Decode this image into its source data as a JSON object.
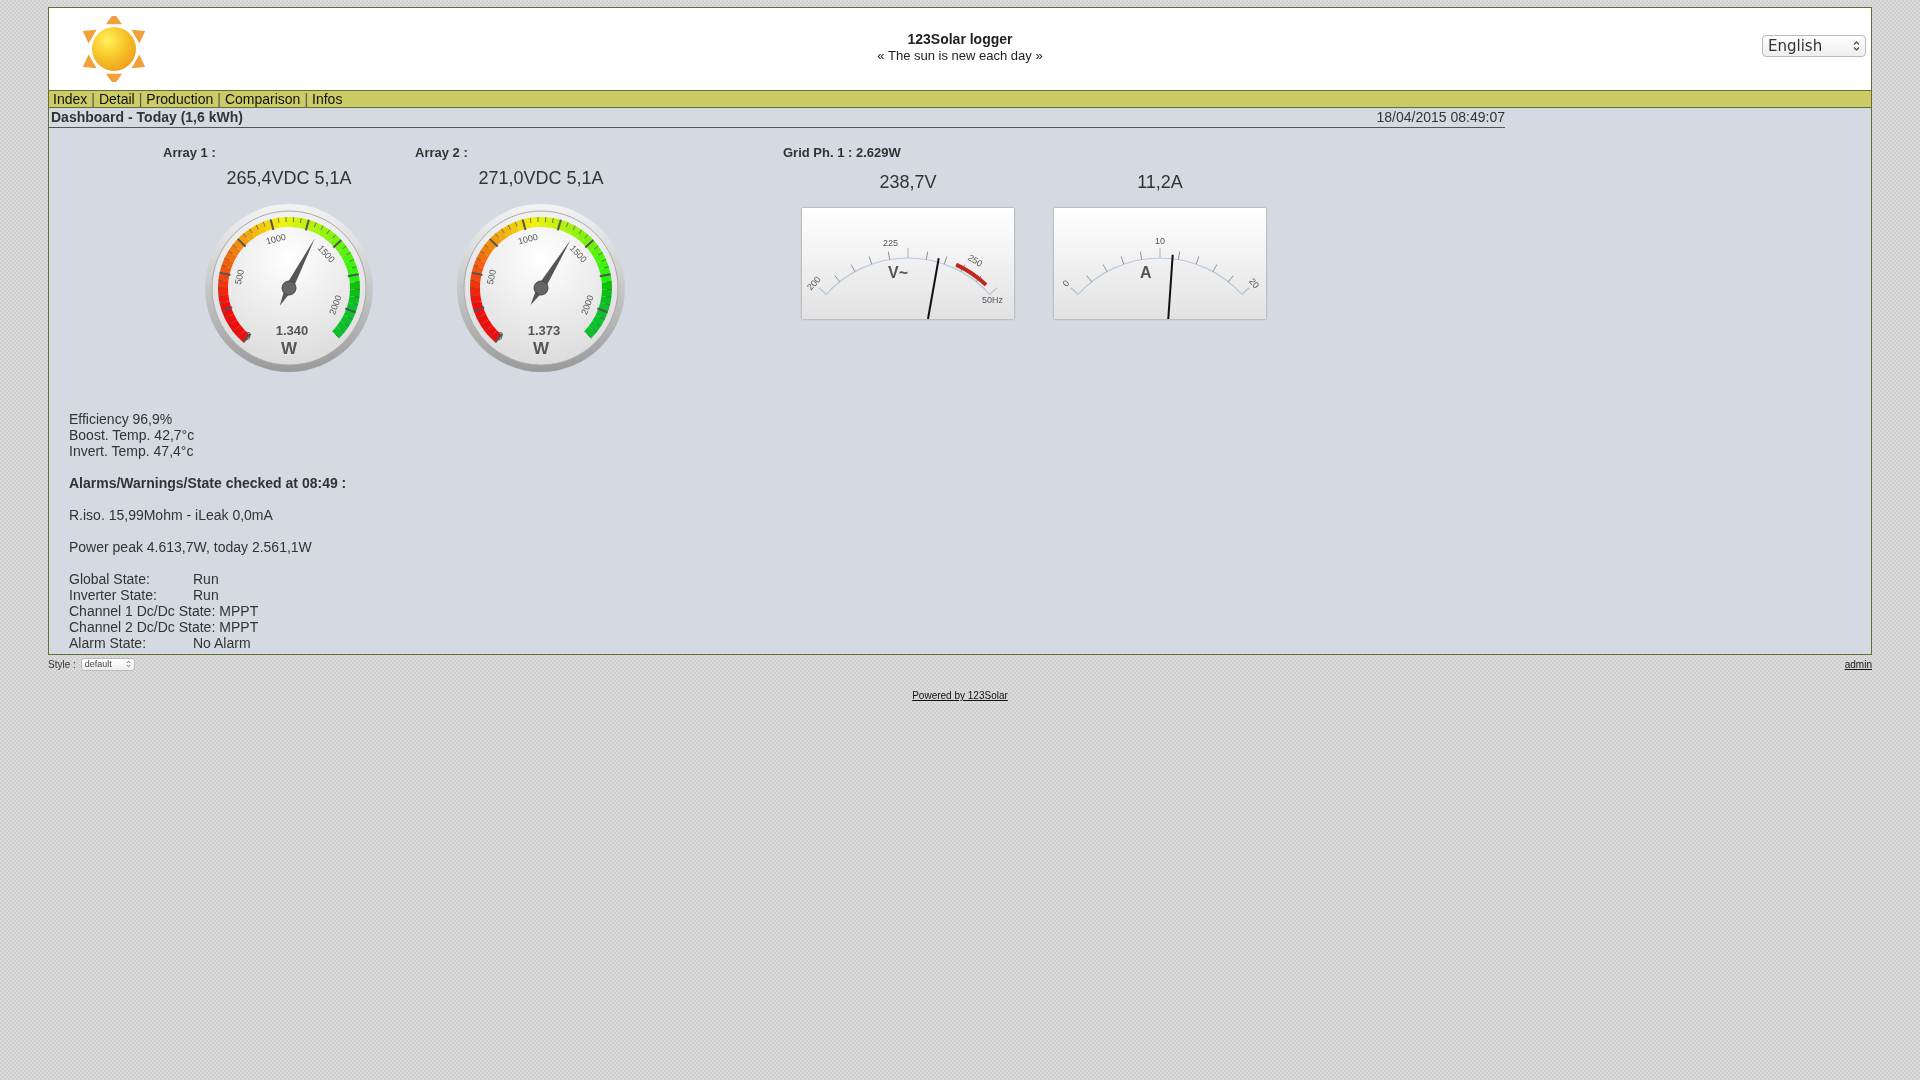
{
  "header": {
    "title": "123Solar logger",
    "subtitle": "« The sun is new each day »",
    "language": "English"
  },
  "nav": [
    {
      "kind": "link",
      "label": "Index"
    },
    {
      "kind": "separator",
      "label": "|"
    },
    {
      "kind": "link",
      "label": "Detail"
    },
    {
      "kind": "separator",
      "label": "|"
    },
    {
      "kind": "link",
      "label": "Production"
    },
    {
      "kind": "separator",
      "label": "|"
    },
    {
      "kind": "link",
      "label": "Comparison"
    },
    {
      "kind": "separator",
      "label": "|"
    },
    {
      "kind": "link",
      "label": "Infos"
    }
  ],
  "dashboard": {
    "title": "Dashboard - Today (1,6 kWh)",
    "datetime": "18/04/2015 08:49:07"
  },
  "arrays": [
    {
      "label": "Array 1 :",
      "reading": "265,4VDC 5,1A",
      "gauge": {
        "scale": [
          "0",
          "500",
          "1000",
          "1500",
          "2000"
        ],
        "value": "1.340",
        "unit": "W",
        "level": 0.609
      }
    },
    {
      "label": "Array 2 :",
      "reading": "271,0VDC 5,1A",
      "gauge": {
        "scale": [
          "0",
          "500",
          "1000",
          "1500",
          "2000"
        ],
        "value": "1.373",
        "unit": "W",
        "level": 0.624
      }
    }
  ],
  "grid": {
    "label": "Grid Ph. 1 : 2.629W",
    "meters": [
      {
        "kind": "voltage",
        "reading": "238,7V",
        "scale": [
          "200",
          "225",
          "250"
        ],
        "unit": "V~",
        "note": "50Hz",
        "level": 0.645
      },
      {
        "kind": "current",
        "reading": "11,2A",
        "scale": [
          "0",
          "10",
          "20"
        ],
        "unit": "A",
        "level": 0.56
      }
    ]
  },
  "stats": [
    "Efficiency 96,9%",
    "Boost. Temp. 42,7°c",
    "Invert. Temp. 47,4°c"
  ],
  "alarms_heading": "Alarms/Warnings/State checked at 08:49 :",
  "insulation": "R.iso. 15,99Mohm - iLeak 0,0mA",
  "power_peak": "Power peak 4.613,7W, today 2.561,1W",
  "states": [
    {
      "label": "Global State:",
      "value": "Run"
    },
    {
      "label": "Inverter State:",
      "value": "Run"
    },
    {
      "label": "Channel 1 Dc/Dc State:",
      "value": "MPPT"
    },
    {
      "label": "Channel 2 Dc/Dc State:",
      "value": "MPPT"
    },
    {
      "label": "Alarm State:",
      "value": "No Alarm"
    }
  ],
  "footer": {
    "style_label": "Style :",
    "style_value": "default",
    "admin": "admin",
    "powered": "Powered by 123Solar"
  }
}
